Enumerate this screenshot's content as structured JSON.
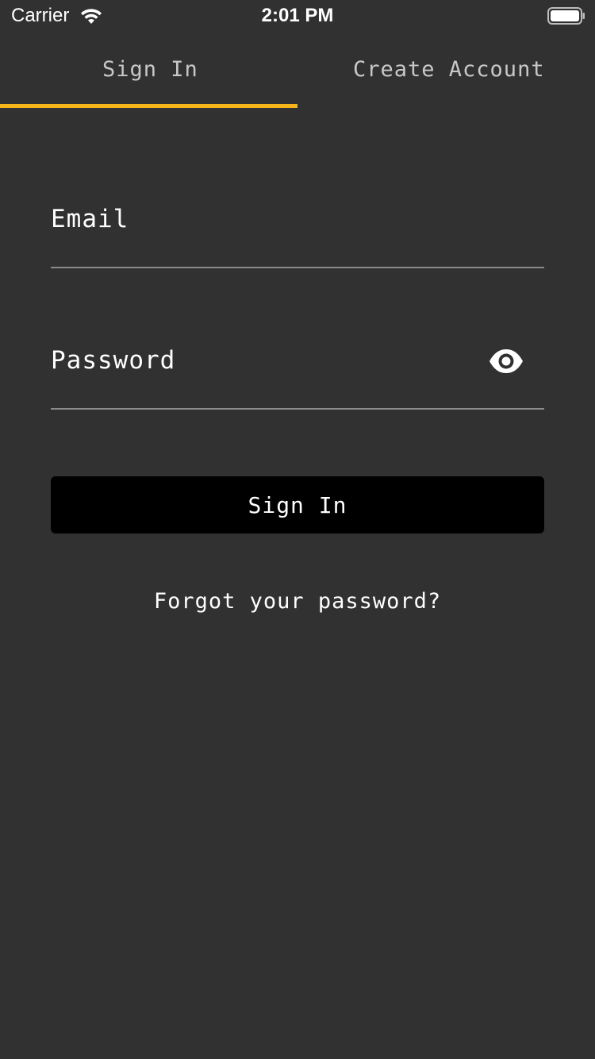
{
  "status_bar": {
    "carrier": "Carrier",
    "time": "2:01 PM",
    "wifi_icon": "wifi-icon",
    "battery_icon": "battery-icon"
  },
  "tabs": [
    {
      "label": "Sign In",
      "selected": true
    },
    {
      "label": "Create Account",
      "selected": false
    }
  ],
  "colors": {
    "background": "#313131",
    "accent": "#f5b41a",
    "button": "#000000",
    "text": "#ffffff",
    "underline": "#8a8a8a"
  },
  "form": {
    "email": {
      "value": "",
      "placeholder": "Email"
    },
    "password": {
      "value": "",
      "placeholder": "Password",
      "toggle_icon": "eye-icon"
    },
    "submit_label": "Sign In",
    "forgot_label": "Forgot your password?"
  }
}
